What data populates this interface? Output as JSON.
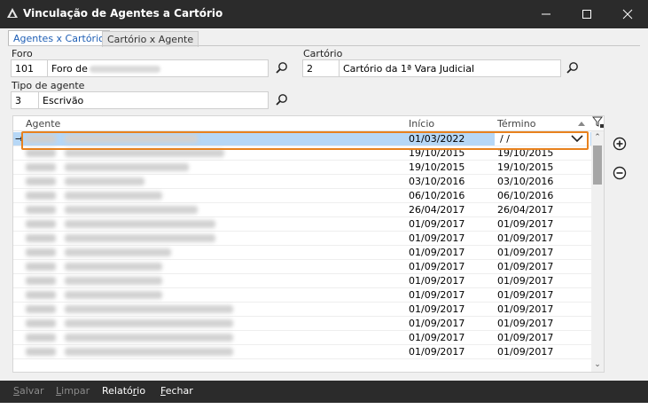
{
  "window": {
    "title": "Vinculação de Agentes a Cartório"
  },
  "tabs": [
    {
      "label": "Agentes x Cartório",
      "active": true
    },
    {
      "label": "Cartório x Agente",
      "active": false
    }
  ],
  "foro": {
    "label": "Foro",
    "code": "101",
    "name": "Foro de"
  },
  "cartorio": {
    "label": "Cartório",
    "code": "2",
    "name": "Cartório da 1ª Vara Judicial"
  },
  "tipo_agente": {
    "label": "Tipo de agente",
    "code": "3",
    "name": "Escrivão"
  },
  "grid": {
    "headers": {
      "agente": "Agente",
      "inicio": "Início",
      "termino": "Término"
    },
    "current_row_indicator": "→",
    "rows": [
      {
        "inicio": "01/03/2022",
        "termino": " / /",
        "selected": true
      },
      {
        "inicio": "19/10/2015",
        "termino": "19/10/2015"
      },
      {
        "inicio": "19/10/2015",
        "termino": "19/10/2015"
      },
      {
        "inicio": "03/10/2016",
        "termino": "03/10/2016"
      },
      {
        "inicio": "06/10/2016",
        "termino": "06/10/2016"
      },
      {
        "inicio": "26/04/2017",
        "termino": "26/04/2017"
      },
      {
        "inicio": "01/09/2017",
        "termino": "01/09/2017"
      },
      {
        "inicio": "01/09/2017",
        "termino": "01/09/2017"
      },
      {
        "inicio": "01/09/2017",
        "termino": "01/09/2017"
      },
      {
        "inicio": "01/09/2017",
        "termino": "01/09/2017"
      },
      {
        "inicio": "01/09/2017",
        "termino": "01/09/2017"
      },
      {
        "inicio": "01/09/2017",
        "termino": "01/09/2017"
      },
      {
        "inicio": "01/09/2017",
        "termino": "01/09/2017"
      },
      {
        "inicio": "01/09/2017",
        "termino": "01/09/2017"
      },
      {
        "inicio": "01/09/2017",
        "termino": "01/09/2017"
      },
      {
        "inicio": "01/09/2017",
        "termino": "01/09/2017"
      }
    ]
  },
  "bottom_buttons": {
    "salvar": {
      "pre": "",
      "key": "S",
      "post": "alvar"
    },
    "limpar": {
      "pre": "",
      "key": "L",
      "post": "impar"
    },
    "relatorio": {
      "pre": "Relató",
      "key": "r",
      "post": "io"
    },
    "fechar": {
      "pre": "",
      "key": "F",
      "post": "echar"
    }
  },
  "colors": {
    "titlebar": "#2b2b2b",
    "selection": "#b6d7f6",
    "highlight_border": "#e8821e",
    "tab_active_text": "#1f5fb5"
  }
}
